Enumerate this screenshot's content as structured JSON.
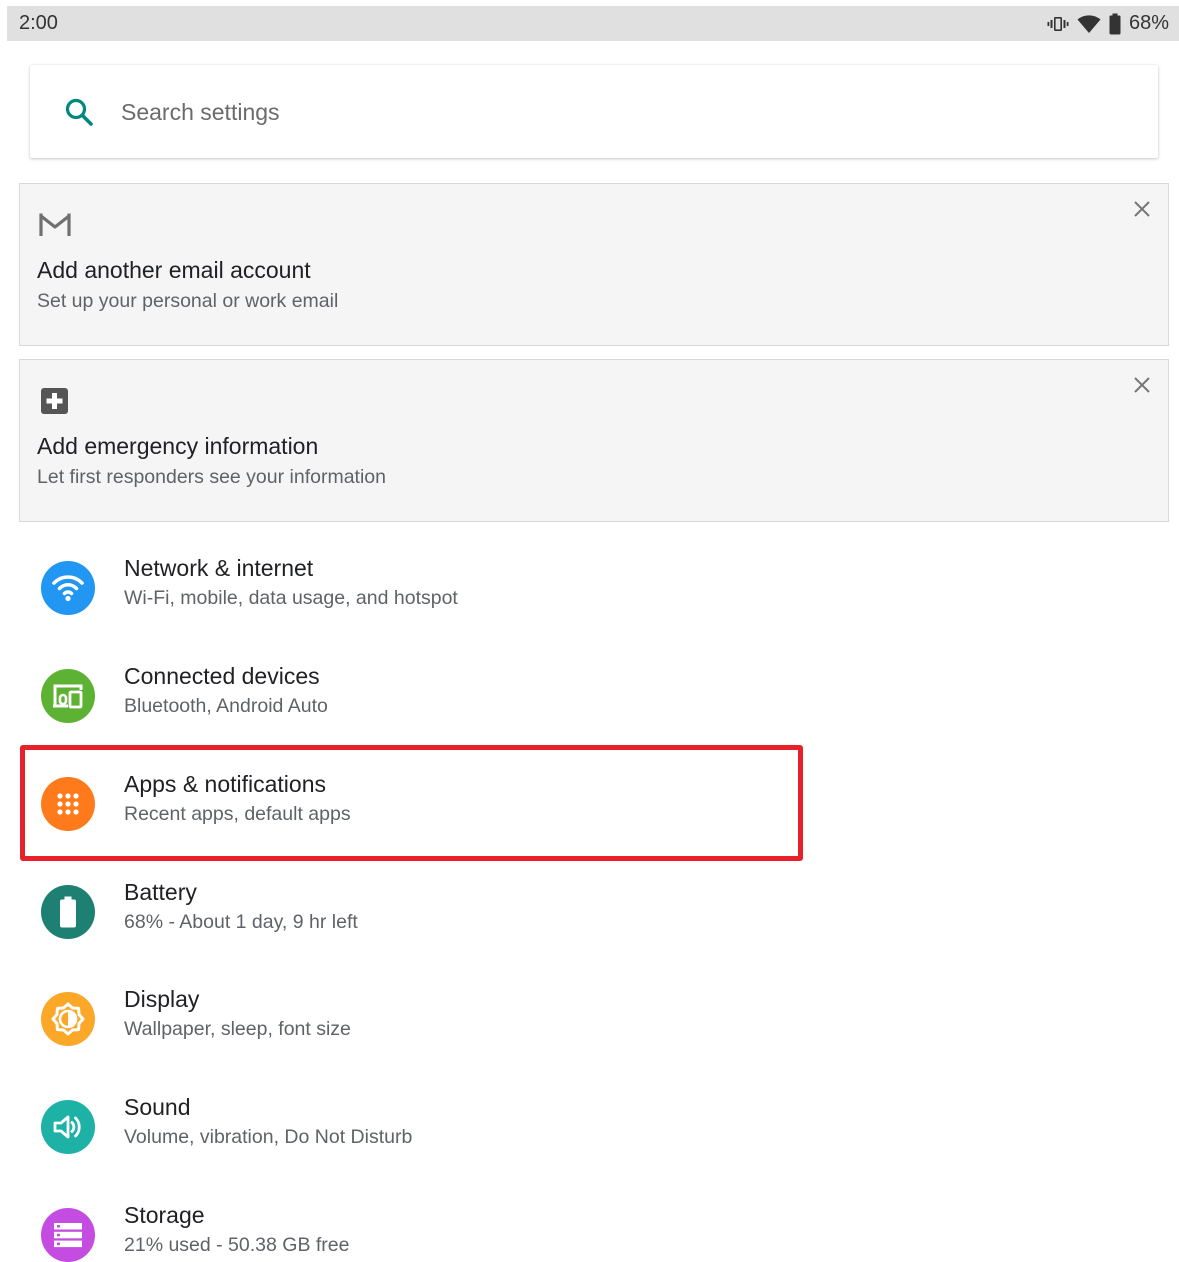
{
  "status_bar": {
    "time": "2:00",
    "battery_percent": "68%",
    "icons": [
      "vibrate-icon",
      "wifi-icon",
      "battery-icon"
    ]
  },
  "search": {
    "placeholder": "Search settings",
    "value": ""
  },
  "suggestions": [
    {
      "icon": "gmail-icon",
      "title": "Add another email account",
      "subtitle": "Set up your personal or work email"
    },
    {
      "icon": "medical-cross-icon",
      "title": "Add emergency information",
      "subtitle": "Let first responders see your information"
    }
  ],
  "settings": [
    {
      "icon": "wifi-icon",
      "color": "#2196F3",
      "title": "Network & internet",
      "subtitle": "Wi-Fi, mobile, data usage, and hotspot"
    },
    {
      "icon": "connected-devices-icon",
      "color": "#5DB234",
      "title": "Connected devices",
      "subtitle": "Bluetooth, Android Auto"
    },
    {
      "icon": "apps-grid-icon",
      "color": "#FF7A1A",
      "title": "Apps & notifications",
      "subtitle": "Recent apps, default apps"
    },
    {
      "icon": "battery-icon",
      "color": "#1E7F73",
      "title": "Battery",
      "subtitle": "68% - About 1 day, 9 hr left"
    },
    {
      "icon": "brightness-icon",
      "color": "#FBA727",
      "title": "Display",
      "subtitle": "Wallpaper, sleep, font size"
    },
    {
      "icon": "volume-icon",
      "color": "#1EB2A6",
      "title": "Sound",
      "subtitle": "Volume, vibration, Do Not Disturb"
    },
    {
      "icon": "storage-icon",
      "color": "#C44CE0",
      "title": "Storage",
      "subtitle": "21% used - 50.38 GB free"
    }
  ],
  "colors": {
    "accent": "#00897B",
    "highlight": "#E8202A"
  }
}
